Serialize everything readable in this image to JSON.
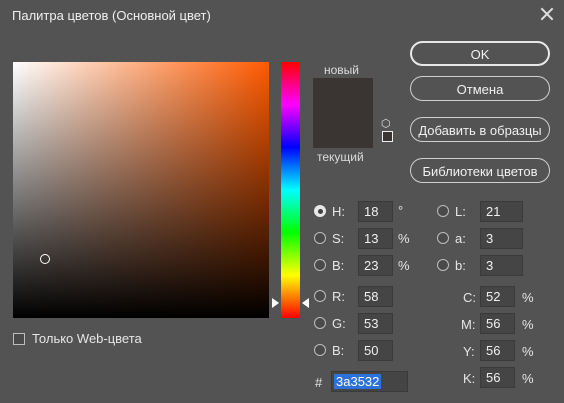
{
  "window": {
    "title": "Палитра цветов (Основной цвет)"
  },
  "swatch": {
    "new_label": "новый",
    "current_label": "текущий",
    "color": "#3a3532"
  },
  "buttons": {
    "ok": "OK",
    "cancel": "Отмена",
    "add_to_swatches": "Добавить в образцы",
    "color_libraries": "Библиотеки цветов"
  },
  "hsb": {
    "h": {
      "label": "H:",
      "value": "18",
      "unit": "°",
      "selected": true
    },
    "s": {
      "label": "S:",
      "value": "13",
      "unit": "%"
    },
    "b": {
      "label": "B:",
      "value": "23",
      "unit": "%"
    }
  },
  "rgb": {
    "r": {
      "label": "R:",
      "value": "58"
    },
    "g": {
      "label": "G:",
      "value": "53"
    },
    "b": {
      "label": "B:",
      "value": "50"
    }
  },
  "lab": {
    "l": {
      "label": "L:",
      "value": "21"
    },
    "a": {
      "label": "a:",
      "value": "3"
    },
    "b": {
      "label": "b:",
      "value": "3"
    }
  },
  "cmyk": {
    "c": {
      "label": "C:",
      "value": "52",
      "unit": "%"
    },
    "m": {
      "label": "M:",
      "value": "56",
      "unit": "%"
    },
    "y": {
      "label": "Y:",
      "value": "56",
      "unit": "%"
    },
    "k": {
      "label": "K:",
      "value": "56",
      "unit": "%"
    }
  },
  "hex": {
    "label": "#",
    "value": "3a3532"
  },
  "web_only": {
    "label": "Только Web-цвета",
    "checked": false
  },
  "colors": {
    "base_hue": "#ff5a00",
    "selection": "#2d72d9",
    "background": "#535353"
  }
}
